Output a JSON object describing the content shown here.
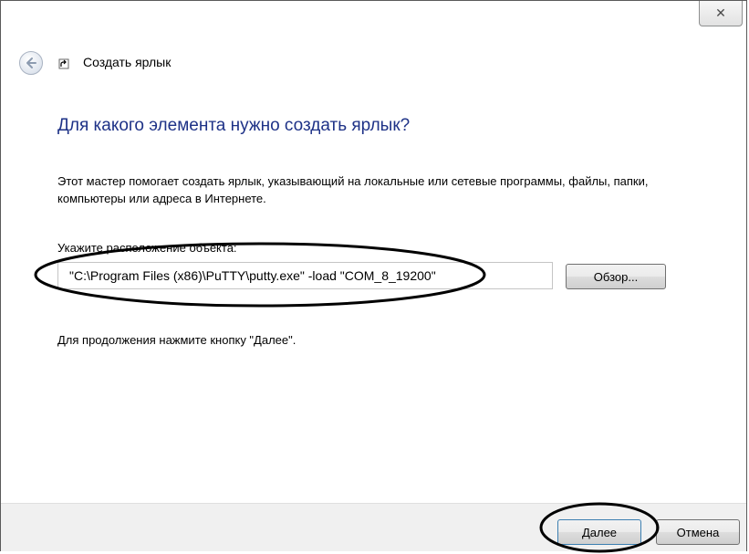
{
  "window": {
    "close_glyph": "✕"
  },
  "header": {
    "title": "Создать ярлык",
    "back_icon": "back-arrow-icon",
    "shortcut_icon": "shortcut-arrow-icon"
  },
  "main": {
    "heading": "Для какого элемента нужно создать ярлык?",
    "description": "Этот мастер помогает создать ярлык, указывающий на локальные или сетевые программы, файлы, папки, компьютеры или адреса в Интернете.",
    "location_label": "Укажите расположение объекта:",
    "location_value": "\"C:\\Program Files (x86)\\PuTTY\\putty.exe\" -load \"COM_8_19200\"",
    "browse_label": "Обзор...",
    "continue_text": "Для продолжения нажмите кнопку \"Далее\"."
  },
  "footer": {
    "next_label": "Далее",
    "cancel_label": "Отмена"
  },
  "colors": {
    "heading": "#1e3287",
    "annotation": "#000000"
  }
}
